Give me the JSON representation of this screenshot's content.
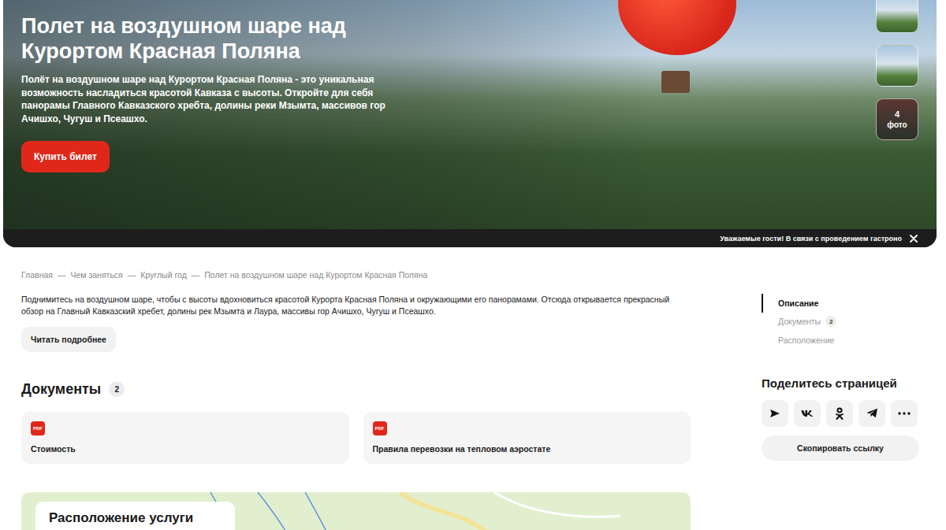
{
  "hero": {
    "title": "Полет на воздушном шаре над Курортом Красная Поляна",
    "description": "Полёт на воздушном шаре над Курортом Красная Поляна - это уникальная возможность насладиться красотой Кавказа с высоты. Откройте для себя панорамы Главного Кавказского хребта, долины реки Мзымта, массивов гор Ачишхо, Чугуш и Псеашхо.",
    "button": "Купить билет",
    "thumbnails": [
      {
        "kind": "photo"
      },
      {
        "kind": "photo"
      },
      {
        "kind": "more",
        "count": "4",
        "label": "фото"
      }
    ]
  },
  "notice": {
    "text": "Уважаемые гости! В связи с проведением гастроно"
  },
  "breadcrumbs": {
    "separator": "—",
    "items": [
      "Главная",
      "Чем заняться",
      "Круглый год",
      "Полет на воздушном шаре над Курортом Красная Поляна"
    ]
  },
  "description": {
    "text": "Поднимитесь на воздушном шаре, чтобы с высоты вдохновиться красотой Курорта Красная Поляна и окружающими его панорамами. Отсюда открывается прекрасный обзор на Главный Кавказский хребет, долины рек Мзымта и Лаура, массивы гор Ачишхо, Чугуш и Псеашхо.",
    "more": "Читать подробнее"
  },
  "documents": {
    "title": "Документы",
    "count": "2",
    "items": [
      {
        "badge": "PDF",
        "title": "Стоимость"
      },
      {
        "badge": "PDF",
        "title": "Правила перевозки на тепловом аэростате"
      }
    ]
  },
  "map": {
    "title": "Расположение услуги"
  },
  "sidebar": {
    "nav": [
      {
        "label": "Описание",
        "count": "",
        "selected": true
      },
      {
        "label": "Документы",
        "count": "2",
        "selected": false
      },
      {
        "label": "Расположение",
        "count": "",
        "selected": false
      }
    ],
    "share": {
      "title": "Поделитесь страницей",
      "buttons": [
        {
          "kind": "share"
        },
        {
          "kind": "vk"
        },
        {
          "kind": "ok"
        },
        {
          "kind": "telegram"
        },
        {
          "kind": "more"
        }
      ],
      "copy": "Скопировать ссылку"
    }
  }
}
